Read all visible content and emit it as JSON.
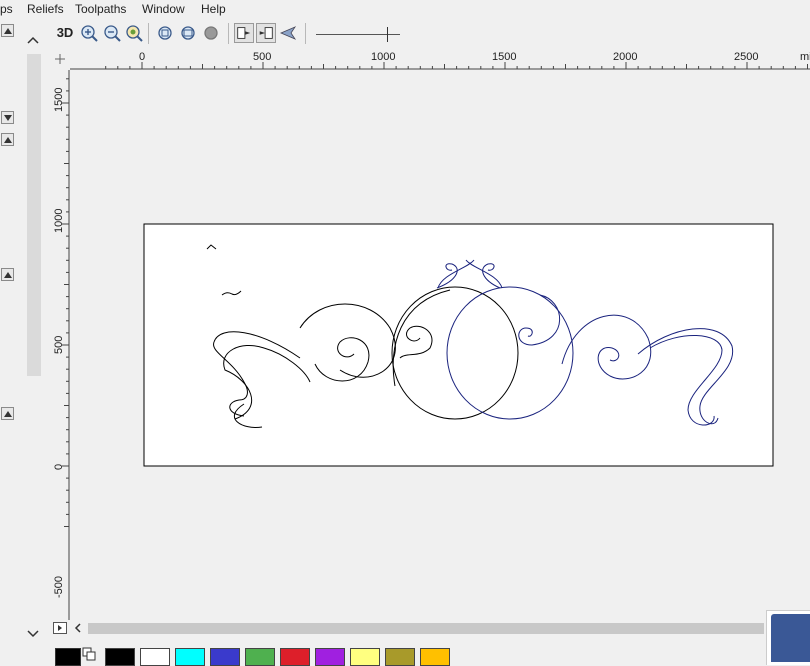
{
  "menu": {
    "items": [
      {
        "label": "ps"
      },
      {
        "label": "Reliefs"
      },
      {
        "label": "Toolpaths"
      },
      {
        "label": "Window"
      },
      {
        "label": "Help"
      }
    ]
  },
  "toolbar": {
    "view3d_label": "3D",
    "buttons": [
      "zoom-in-icon",
      "zoom-out-icon",
      "zoom-search-icon",
      "zoom-extents-icon",
      "zoom-fit-icon",
      "zoom-selection-icon",
      "layout-2d-icon",
      "layout-3d-icon",
      "view-arrow-icon"
    ],
    "slider_level": 0.85
  },
  "ruler": {
    "horizontal_labels": [
      "0",
      "500",
      "1000",
      "1500",
      "2000",
      "2500",
      "mil"
    ],
    "vertical_labels": [
      "1500",
      "1000",
      "500",
      "0",
      "-500"
    ]
  },
  "palette": {
    "colors": [
      "#000000",
      "#ffffff",
      "#00ffff",
      "#3a3acc",
      "#4fb04f",
      "#dd1f2a",
      "#a020e0",
      "#ffff80",
      "#a89a2a",
      "#ffc000"
    ]
  },
  "colors": {
    "vector_black": "#000000",
    "vector_blue": "#1a237e",
    "canvas_bg": "#f0f0f0"
  }
}
